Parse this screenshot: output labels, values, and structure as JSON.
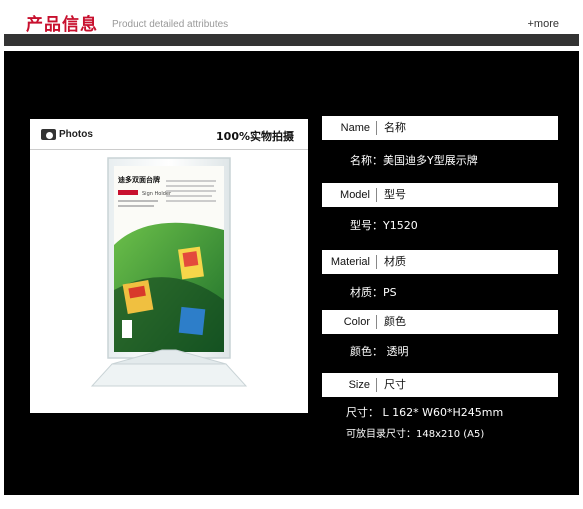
{
  "header": {
    "title": "产品信息",
    "subtitle": "Product detailed attributes",
    "more": "+more"
  },
  "photo": {
    "label": "Photos",
    "caption": "100%实物拍摄",
    "sign_title": "迪多双面台牌",
    "sign_brand": "Sign Holder"
  },
  "specs": [
    {
      "key": "Name",
      "key_cn": "名称",
      "value": "名称：美国迪多Y型展示牌"
    },
    {
      "key": "Model",
      "key_cn": "型号",
      "value": "型号：Y1520"
    },
    {
      "key": "Material",
      "key_cn": "材质",
      "value": "材质：PS"
    },
    {
      "key": "Color",
      "key_cn": "颜色",
      "value": "颜色： 透明"
    },
    {
      "key": "Size",
      "key_cn": "尺寸",
      "value": "尺寸： L 162* W60*H245mm",
      "value2": "可放目录尺寸：148x210 (A5)"
    }
  ],
  "colors": {
    "accent": "#c8102e",
    "panel": "#000000",
    "bar": "#333333"
  }
}
